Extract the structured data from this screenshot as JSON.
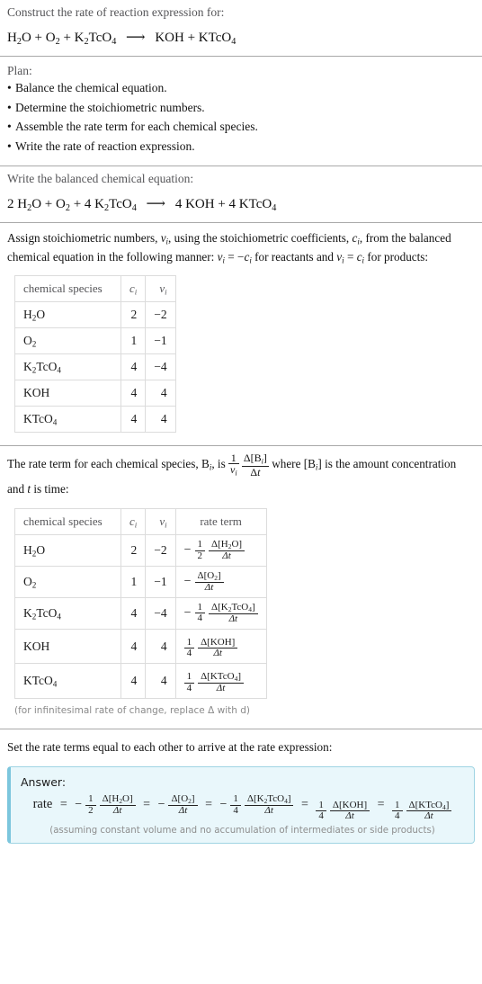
{
  "header": {
    "prompt": "Construct the rate of reaction expression for:",
    "reaction": {
      "reactants": [
        "H2O",
        "O2",
        "K2TcO4"
      ],
      "products": [
        "KOH",
        "KTcO4"
      ],
      "arrow": "⟶",
      "display": "H_2O + O_2 + K_2TcO_4 ⟶ KOH + KTcO_4"
    }
  },
  "plan": {
    "title": "Plan:",
    "steps": [
      "Balance the chemical equation.",
      "Determine the stoichiometric numbers.",
      "Assemble the rate term for each chemical species.",
      "Write the rate of reaction expression."
    ]
  },
  "balanced": {
    "title": "Write the balanced chemical equation:",
    "display": "2 H_2O + O_2 + 4 K_2TcO_4 ⟶ 4 KOH + 4 KTcO_4",
    "reactant_coeffs": [
      "2",
      "",
      "4"
    ],
    "product_coeffs": [
      "4",
      "4"
    ]
  },
  "assign": {
    "text_line1": "Assign stoichiometric numbers, ν_i, using the stoichiometric coefficients, c_i, from",
    "text_line2": "the balanced chemical equation in the following manner: ν_i = −c_i for reactants",
    "text_line3": "and ν_i = c_i for products:"
  },
  "table_stoich": {
    "headers": [
      "chemical species",
      "c_i",
      "ν_i"
    ],
    "rows": [
      {
        "species": "H2O",
        "c": "2",
        "v": "-2"
      },
      {
        "species": "O2",
        "c": "1",
        "v": "-1"
      },
      {
        "species": "K2TcO4",
        "c": "4",
        "v": "-4"
      },
      {
        "species": "KOH",
        "c": "4",
        "v": "4"
      },
      {
        "species": "KTcO4",
        "c": "4",
        "v": "4"
      }
    ]
  },
  "rate_intro": {
    "text_line1": "The rate term for each chemical species, B_i, is  1/ν_i · Δ[B_i]/Δt  where [B_i] is the amount",
    "text_line2": "concentration and t is time:"
  },
  "table_rate": {
    "headers": [
      "chemical species",
      "c_i",
      "ν_i",
      "rate term"
    ],
    "rows": [
      {
        "species": "H2O",
        "c": "2",
        "v": "-2",
        "sign": "-",
        "coef_num": "1",
        "coef_den": "2",
        "delta": "Δ[H2O]",
        "dt": "Δt"
      },
      {
        "species": "O2",
        "c": "1",
        "v": "-1",
        "sign": "-",
        "coef_num": "",
        "coef_den": "",
        "delta": "Δ[O2]",
        "dt": "Δt"
      },
      {
        "species": "K2TcO4",
        "c": "4",
        "v": "-4",
        "sign": "-",
        "coef_num": "1",
        "coef_den": "4",
        "delta": "Δ[K2TcO4]",
        "dt": "Δt"
      },
      {
        "species": "KOH",
        "c": "4",
        "v": "4",
        "sign": "",
        "coef_num": "1",
        "coef_den": "4",
        "delta": "Δ[KOH]",
        "dt": "Δt"
      },
      {
        "species": "KTcO4",
        "c": "4",
        "v": "4",
        "sign": "",
        "coef_num": "1",
        "coef_den": "4",
        "delta": "Δ[KTcO4]",
        "dt": "Δt"
      }
    ],
    "footnote": "(for infinitesimal rate of change, replace Δ with d)"
  },
  "final_prompt": "Set the rate terms equal to each other to arrive at the rate expression:",
  "answer": {
    "label": "Answer:",
    "rate_word": "rate",
    "equals": "=",
    "terms": [
      {
        "sign": "-",
        "coef_num": "1",
        "coef_den": "2",
        "delta": "Δ[H2O]",
        "dt": "Δt"
      },
      {
        "sign": "-",
        "coef_num": "",
        "coef_den": "",
        "delta": "Δ[O2]",
        "dt": "Δt"
      },
      {
        "sign": "-",
        "coef_num": "1",
        "coef_den": "4",
        "delta": "Δ[K2TcO4]",
        "dt": "Δt"
      },
      {
        "sign": "",
        "coef_num": "1",
        "coef_den": "4",
        "delta": "Δ[KOH]",
        "dt": "Δt"
      },
      {
        "sign": "",
        "coef_num": "1",
        "coef_den": "4",
        "delta": "Δ[KTcO4]",
        "dt": "Δt"
      }
    ],
    "assumption": "(assuming constant volume and no accumulation of intermediates or side products)"
  },
  "colors": {
    "answer_bg": "#e9f7fb",
    "answer_border": "#9fd4e3",
    "answer_accent": "#7cc6dd",
    "rule": "#a9a9a9",
    "table_border": "#dcdcdc",
    "muted_text": "#555558"
  }
}
